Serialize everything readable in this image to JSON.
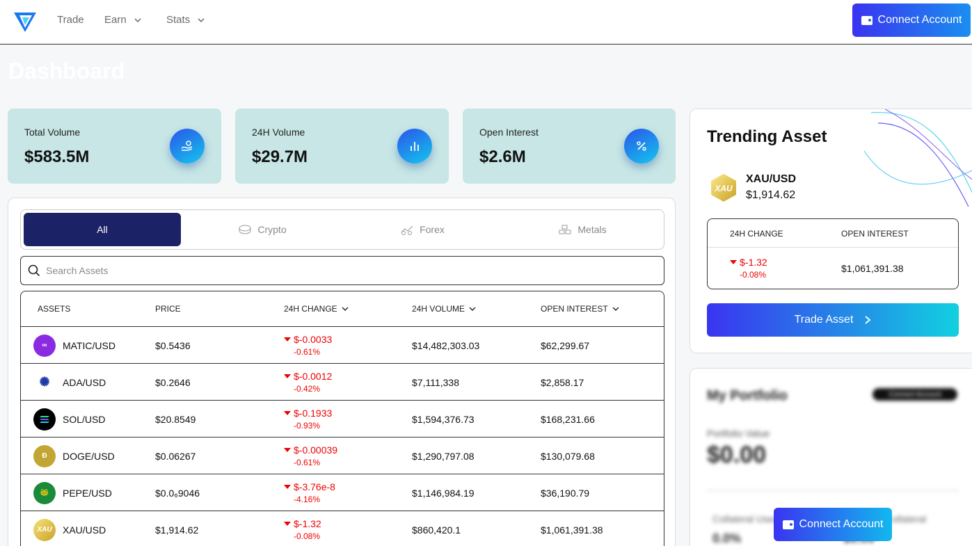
{
  "nav": {
    "items": [
      "Trade",
      "Earn",
      "Stats"
    ],
    "connect_label": "Connect Account"
  },
  "page_title": "Dashboard",
  "stats": [
    {
      "label": "Total Volume",
      "value": "$583.5M",
      "icon": "hand-coins-icon"
    },
    {
      "label": "24H Volume",
      "value": "$29.7M",
      "icon": "bar-chart-icon"
    },
    {
      "label": "Open Interest",
      "value": "$2.6M",
      "icon": "percent-icon"
    }
  ],
  "tabs": [
    {
      "label": "All",
      "icon": ""
    },
    {
      "label": "Crypto",
      "icon": "coins-icon"
    },
    {
      "label": "Forex",
      "icon": "forex-chart-icon"
    },
    {
      "label": "Metals",
      "icon": "metal-bars-icon"
    }
  ],
  "search": {
    "placeholder": "Search Assets"
  },
  "table": {
    "headers": [
      "ASSETS",
      "PRICE",
      "24H CHANGE",
      "24H VOLUME",
      "OPEN INTEREST"
    ],
    "rows": [
      {
        "asset": "MATIC/USD",
        "price": "$0.5436",
        "change": "$-0.0033",
        "pct": "-0.61%",
        "volume": "$14,482,303.03",
        "oi": "$62,299.67",
        "icon_color": "#8a2be2"
      },
      {
        "asset": "ADA/USD",
        "price": "$0.2646",
        "change": "$-0.0012",
        "pct": "-0.42%",
        "volume": "$7,111,338",
        "oi": "$2,858.17",
        "icon_color": "#1e3aa8"
      },
      {
        "asset": "SOL/USD",
        "price": "$20.8549",
        "change": "$-0.1933",
        "pct": "-0.93%",
        "volume": "$1,594,376.73",
        "oi": "$168,231.66",
        "icon_color": "#000000"
      },
      {
        "asset": "DOGE/USD",
        "price": "$0.06267",
        "change": "$-0.00039",
        "pct": "-0.61%",
        "volume": "$1,290,797.08",
        "oi": "$130,079.68",
        "icon_color": "#c2a633"
      },
      {
        "asset": "PEPE/USD",
        "price": "$0.0₆9046",
        "change": "$-3.76e-8",
        "pct": "-4.16%",
        "volume": "$1,146,984.19",
        "oi": "$36,190.79",
        "icon_color": "#1b8a3a"
      },
      {
        "asset": "XAU/USD",
        "price": "$1,914.62",
        "change": "$-1.32",
        "pct": "-0.08%",
        "volume": "$860,420.1",
        "oi": "$1,061,391.38",
        "icon_color": "#e6c34a"
      }
    ]
  },
  "trending": {
    "title": "Trending Asset",
    "pair": "XAU/USD",
    "price": "$1,914.62",
    "change_header": "24H CHANGE",
    "oi_header": "OPEN INTEREST",
    "change": "$-1.32",
    "pct": "-0.08%",
    "oi": "$1,061,391.38",
    "trade_label": "Trade Asset"
  },
  "portfolio": {
    "title": "My Portfolio",
    "badge": "Connect Account",
    "value_label": "Portfolio Value",
    "value": "$0.00",
    "col1_label": "Collateral Used",
    "col1_value": "0.0%",
    "col2_label": "Collateral",
    "col2_value": "$0.00"
  },
  "colors": {
    "negative": "#e00000",
    "accent": "#3a34f0",
    "active_tab": "#1c2266",
    "card_bg": "#c7e6e5"
  }
}
